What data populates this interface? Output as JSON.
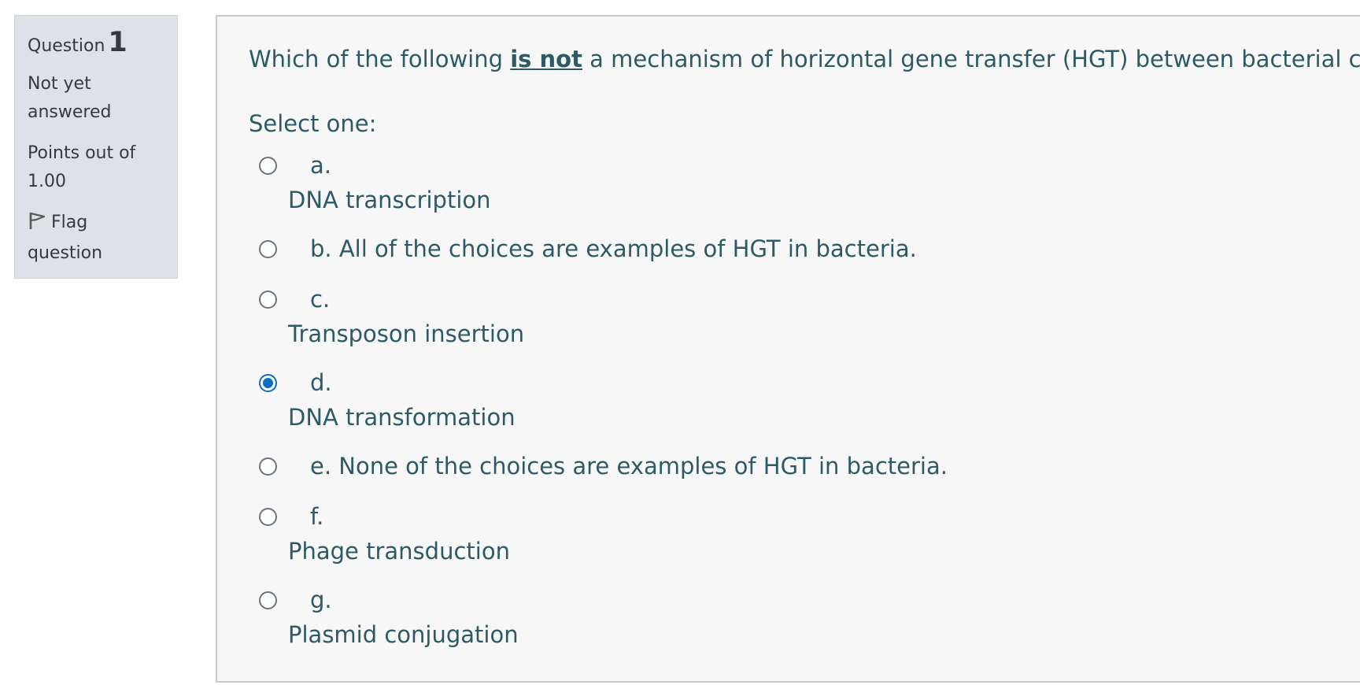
{
  "info": {
    "question_label": "Question",
    "question_number": "1",
    "status": "Not yet answered",
    "points": "Points out of 1.00",
    "flag_label": "Flag question"
  },
  "question": {
    "text_before": "Which of the following ",
    "text_emphasis": "is not",
    "text_after": " a mechanism of horizontal gene transfer (HGT) between bacterial cells?",
    "select_label": "Select one:"
  },
  "options": [
    {
      "letter": "a.",
      "text": "DNA transcription",
      "selected": false
    },
    {
      "letter": "b. All of the choices are examples of HGT in bacteria.",
      "text": "",
      "selected": false
    },
    {
      "letter": "c.",
      "text": "Transposon insertion",
      "selected": false
    },
    {
      "letter": "d.",
      "text": "DNA transformation",
      "selected": true
    },
    {
      "letter": "e. None of the choices are examples of HGT in bacteria.",
      "text": "",
      "selected": false
    },
    {
      "letter": "f.",
      "text": "Phage transduction",
      "selected": false
    },
    {
      "letter": "g.",
      "text": "Plasmid conjugation",
      "selected": false
    }
  ],
  "colors": {
    "text": "#2c5a66",
    "accent": "#0f6cbf",
    "info_bg": "#dee2e6",
    "panel_bg": "#f7f7f7"
  },
  "icons": {
    "flag": "flag-icon",
    "radio": "radio-icon"
  }
}
